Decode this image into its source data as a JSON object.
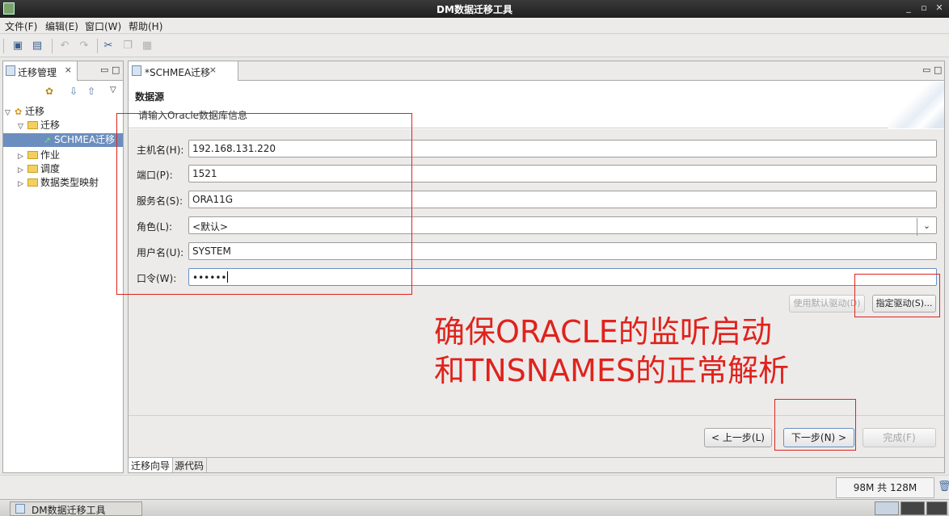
{
  "window": {
    "title": "DM数据迁移工具",
    "minimize": "_",
    "maximize": "▫",
    "close": "✕"
  },
  "menu": [
    "文件(F)",
    "编辑(E)",
    "窗口(W)",
    "帮助(H)"
  ],
  "left_panel": {
    "tab_label": "迁移管理",
    "tab_close": "⨯",
    "tree": [
      {
        "label": "迁移",
        "level": 0,
        "expanded": true
      },
      {
        "label": "迁移",
        "level": 1,
        "expanded": true
      },
      {
        "label": "SCHMEA迁移",
        "level": 2,
        "selected": true
      },
      {
        "label": "作业",
        "level": 1,
        "expanded": false
      },
      {
        "label": "调度",
        "level": 1,
        "expanded": false
      },
      {
        "label": "数据类型映射",
        "level": 1,
        "expanded": false
      }
    ]
  },
  "editor": {
    "tab_label": "*SCHMEA迁移",
    "tab_close": "⨯",
    "section_title": "数据源",
    "section_desc": "请输入Oracle数据库信息",
    "fields": [
      {
        "label": "主机名(H):",
        "value": "192.168.131.220"
      },
      {
        "label": "端口(P):",
        "value": "1521"
      },
      {
        "label": "服务名(S):",
        "value": "ORA11G"
      },
      {
        "label": "角色(L):",
        "value": "<默认>",
        "dropdown_arrow": "⌄"
      },
      {
        "label": "用户名(U):",
        "value": "SYSTEM"
      },
      {
        "label": "口令(W):",
        "value": "••••••"
      }
    ],
    "use_default_driver": "使用默认驱动(D)",
    "specify_driver": "指定驱动(S)...",
    "prev_button": "< 上一步(L)",
    "next_button": "下一步(N) >",
    "finish_button": "完成(F)",
    "bottom_tabs": [
      "迁移向导",
      "源代码"
    ]
  },
  "annotation": {
    "line1": "确保ORACLE的监听启动",
    "line2": "和TNSNAMES的正常解析",
    "color": "#e0221c"
  },
  "status": {
    "memory": "98M 共 128M"
  },
  "taskbar": {
    "item": "DM数据迁移工具"
  }
}
